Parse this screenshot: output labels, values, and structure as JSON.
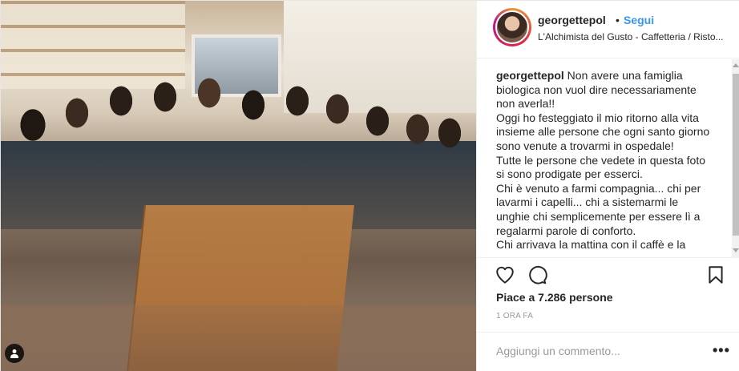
{
  "post": {
    "username": "georgettepol",
    "separator": "•",
    "follow_label": "Segui",
    "location": "L'Alchimista del Gusto - Caffetteria / Risto...",
    "caption_username": "georgettepol",
    "caption_lines": [
      "Non avere una famiglia biologica non vuol dire necessariamente non averla!!",
      "Oggi ho festeggiato il mio ritorno alla vita insieme alle persone che ogni santo giorno sono venute a trovarmi in ospedale!",
      "Tutte le persone che vedete in questa foto si sono prodigate per esserci.",
      "Chi è venuto a farmi compagnia... chi per lavarmi i capelli... chi a sistemarmi le unghie chi semplicemente per essere lì a regalarmi parole di conforto.",
      "Chi arrivava la mattina con il caffè e la"
    ],
    "likes": "Piace a 7.286 persone",
    "time": "1 ORA FA",
    "comment_placeholder": "Aggiungi un commento...",
    "more_label": "•••"
  },
  "icons": {
    "like": "heart-icon",
    "comment": "comment-icon",
    "save": "bookmark-icon",
    "tag": "user-tag-icon"
  }
}
